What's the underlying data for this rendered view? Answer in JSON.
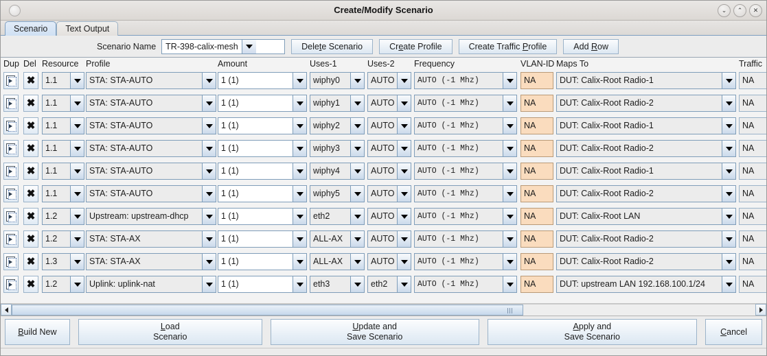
{
  "window": {
    "title": "Create/Modify Scenario",
    "controls": [
      {
        "name": "minimize-button",
        "glyph": "⌄"
      },
      {
        "name": "maximize-button",
        "glyph": "⌃"
      },
      {
        "name": "close-button",
        "glyph": "✕"
      }
    ]
  },
  "tabs": [
    {
      "label": "Scenario",
      "active": true
    },
    {
      "label": "Text Output",
      "active": false
    }
  ],
  "toolbar": {
    "scenario_name_label": "Scenario Name",
    "scenario_name_value": "TR-398-calix-mesh",
    "buttons": [
      {
        "name": "delete-scenario-button",
        "pre": "Dele",
        "key": "t",
        "post": "e Scenario"
      },
      {
        "name": "create-profile-button",
        "pre": "Cr",
        "key": "e",
        "post": "ate Profile"
      },
      {
        "name": "create-traffic-profile-button",
        "pre": "Create Traffic ",
        "key": "P",
        "post": "rofile"
      },
      {
        "name": "add-row-button",
        "pre": "Add ",
        "key": "R",
        "post": "ow"
      }
    ]
  },
  "table": {
    "headers": [
      "Dup",
      "Del",
      "Resource",
      "Profile",
      "Amount",
      "Uses-1",
      "Uses-2",
      "Frequency",
      "VLAN-ID",
      "Maps To",
      "Traffic"
    ],
    "rows": [
      {
        "resource": "1.1",
        "profile": "STA: STA-AUTO",
        "amount": "1 (1)",
        "uses1": "wiphy0",
        "uses2": "AUTO",
        "frequency": "AUTO (-1 Mhz)",
        "vlan": "NA",
        "maps_to": "DUT: Calix-Root Radio-1",
        "traffic": "NA"
      },
      {
        "resource": "1.1",
        "profile": "STA: STA-AUTO",
        "amount": "1 (1)",
        "uses1": "wiphy1",
        "uses2": "AUTO",
        "frequency": "AUTO (-1 Mhz)",
        "vlan": "NA",
        "maps_to": "DUT: Calix-Root Radio-2",
        "traffic": "NA"
      },
      {
        "resource": "1.1",
        "profile": "STA: STA-AUTO",
        "amount": "1 (1)",
        "uses1": "wiphy2",
        "uses2": "AUTO",
        "frequency": "AUTO (-1 Mhz)",
        "vlan": "NA",
        "maps_to": "DUT: Calix-Root Radio-1",
        "traffic": "NA"
      },
      {
        "resource": "1.1",
        "profile": "STA: STA-AUTO",
        "amount": "1 (1)",
        "uses1": "wiphy3",
        "uses2": "AUTO",
        "frequency": "AUTO (-1 Mhz)",
        "vlan": "NA",
        "maps_to": "DUT: Calix-Root Radio-2",
        "traffic": "NA"
      },
      {
        "resource": "1.1",
        "profile": "STA: STA-AUTO",
        "amount": "1 (1)",
        "uses1": "wiphy4",
        "uses2": "AUTO",
        "frequency": "AUTO (-1 Mhz)",
        "vlan": "NA",
        "maps_to": "DUT: Calix-Root Radio-1",
        "traffic": "NA"
      },
      {
        "resource": "1.1",
        "profile": "STA: STA-AUTO",
        "amount": "1 (1)",
        "uses1": "wiphy5",
        "uses2": "AUTO",
        "frequency": "AUTO (-1 Mhz)",
        "vlan": "NA",
        "maps_to": "DUT: Calix-Root Radio-2",
        "traffic": "NA"
      },
      {
        "resource": "1.2",
        "profile": "Upstream: upstream-dhcp",
        "amount": "1 (1)",
        "uses1": "eth2",
        "uses2": "AUTO",
        "frequency": "AUTO (-1 Mhz)",
        "vlan": "NA",
        "maps_to": "DUT: Calix-Root LAN",
        "traffic": "NA"
      },
      {
        "resource": "1.2",
        "profile": "STA: STA-AX",
        "amount": "1 (1)",
        "uses1": "ALL-AX",
        "uses2": "AUTO",
        "frequency": "AUTO (-1 Mhz)",
        "vlan": "NA",
        "maps_to": "DUT: Calix-Root Radio-2",
        "traffic": "NA"
      },
      {
        "resource": "1.3",
        "profile": "STA: STA-AX",
        "amount": "1 (1)",
        "uses1": "ALL-AX",
        "uses2": "AUTO",
        "frequency": "AUTO (-1 Mhz)",
        "vlan": "NA",
        "maps_to": "DUT: Calix-Root Radio-2",
        "traffic": "NA"
      },
      {
        "resource": "1.2",
        "profile": "Uplink: uplink-nat",
        "amount": "1 (1)",
        "uses1": "eth3",
        "uses2": "eth2",
        "frequency": "AUTO (-1 Mhz)",
        "vlan": "NA",
        "maps_to": "DUT: upstream LAN 192.168.100.1/24",
        "traffic": "NA"
      }
    ]
  },
  "bottom_buttons": [
    {
      "name": "build-new-button",
      "pre": "",
      "key": "B",
      "post": "uild New",
      "line2": ""
    },
    {
      "name": "load-scenario-button",
      "pre": "",
      "key": "L",
      "post": "oad",
      "line2": "Scenario"
    },
    {
      "name": "update-and-save-scenario-button",
      "pre": "",
      "key": "U",
      "post": "pdate and",
      "line2": "Save Scenario"
    },
    {
      "name": "apply-and-save-scenario-button",
      "pre": "",
      "key": "A",
      "post": "pply and",
      "line2": "Save Scenario"
    },
    {
      "name": "cancel-button",
      "pre": "",
      "key": "C",
      "post": "ancel",
      "line2": ""
    }
  ],
  "colors": {
    "accent": "#7f9db9",
    "vlan_bg": "#fadcbe",
    "tab_active": "#cfe0f3"
  }
}
